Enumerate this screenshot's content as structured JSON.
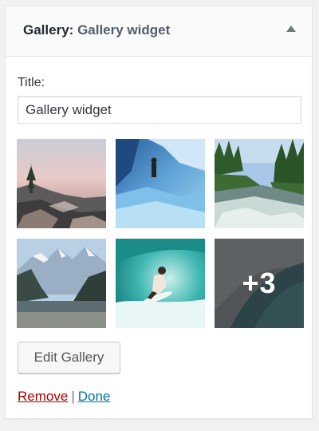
{
  "widget": {
    "type_label": "Gallery",
    "separator": ":",
    "instance_title": "Gallery widget",
    "toggle_icon": "arrow-up-icon"
  },
  "form": {
    "title_label": "Title:",
    "title_value": "Gallery widget"
  },
  "gallery": {
    "thumbnails": [
      {
        "name": "coastal-rocks-sunset"
      },
      {
        "name": "ice-cave-hiker"
      },
      {
        "name": "forest-river"
      },
      {
        "name": "mountain-fjord"
      },
      {
        "name": "surfer-wave"
      },
      {
        "name": "ocean-wave"
      }
    ],
    "more_count_label": "+3"
  },
  "buttons": {
    "edit_gallery": "Edit Gallery"
  },
  "actions": {
    "remove": "Remove",
    "separator": "|",
    "done": "Done"
  },
  "colors": {
    "remove_link": "#aa0000",
    "done_link": "#0073aa"
  }
}
